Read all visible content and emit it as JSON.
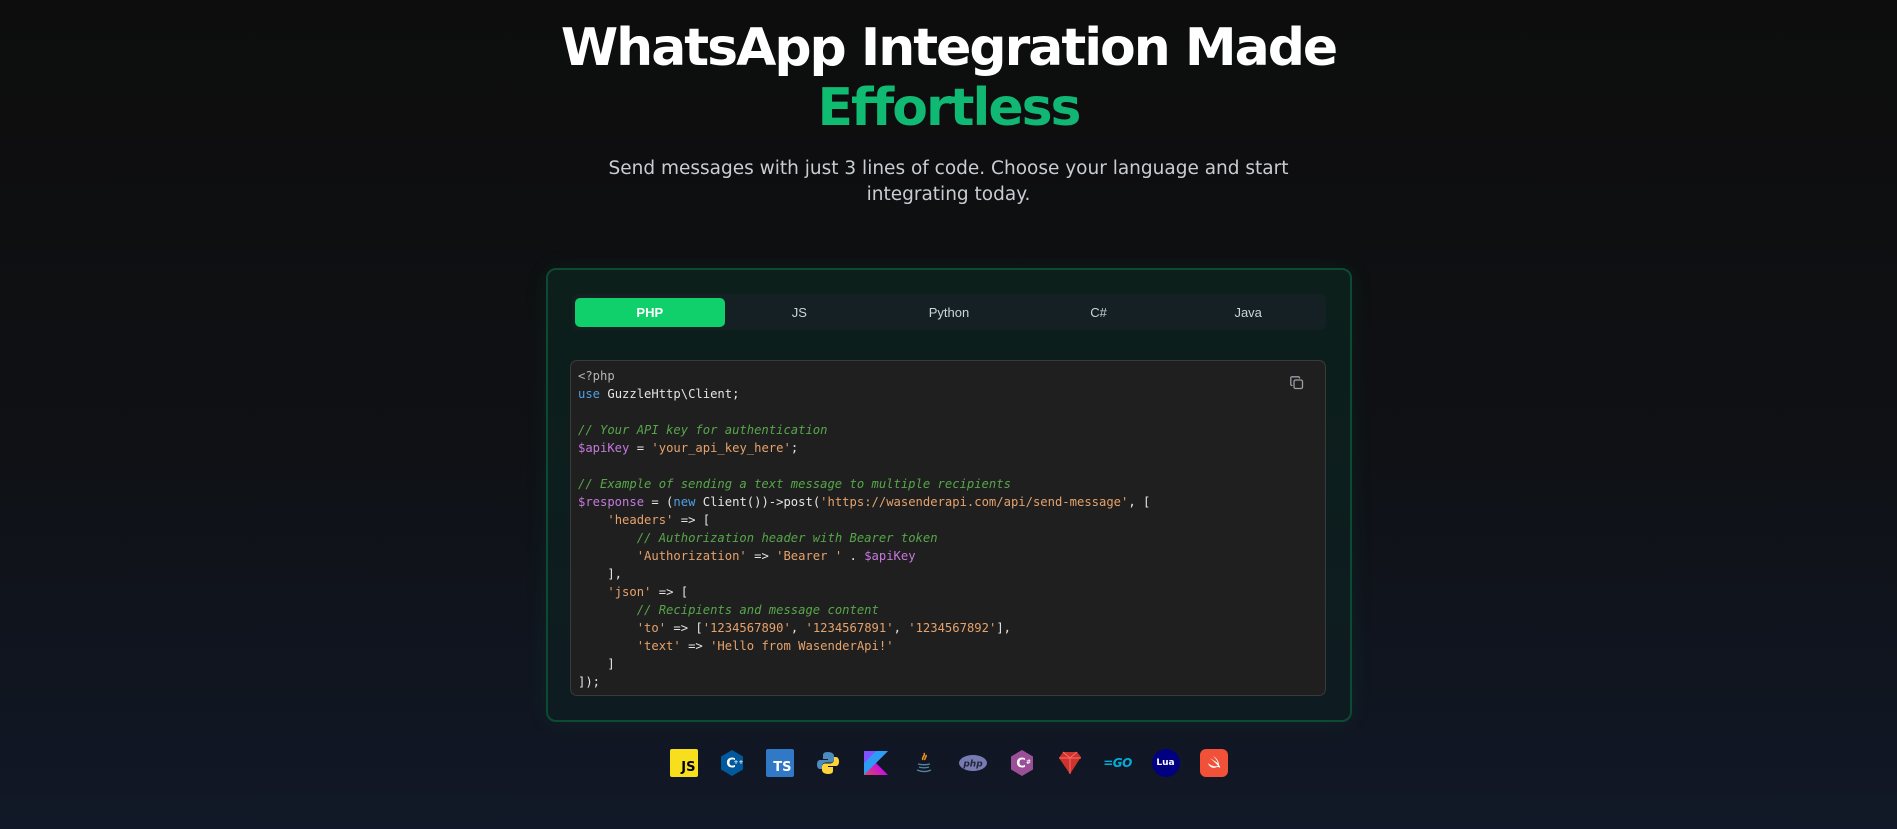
{
  "hero": {
    "title_line1": "WhatsApp Integration Made",
    "title_line2": "Effortless",
    "subtitle": "Send messages with just 3 lines of code. Choose your language and start integrating today."
  },
  "tabs": [
    {
      "label": "PHP",
      "active": true
    },
    {
      "label": "JS",
      "active": false
    },
    {
      "label": "Python",
      "active": false
    },
    {
      "label": "C#",
      "active": false
    },
    {
      "label": "Java",
      "active": false
    }
  ],
  "code": {
    "language": "php",
    "lines": [
      "<?php",
      "use GuzzleHttp\\Client;",
      "",
      "// Your API key for authentication",
      "$apiKey = 'your_api_key_here';",
      "",
      "// Example of sending a text message to multiple recipients",
      "$response = (new Client())->post('https://wasenderapi.com/api/send-message', [",
      "    'headers' => [",
      "        // Authorization header with Bearer token",
      "        'Authorization' => 'Bearer ' . $apiKey",
      "    ],",
      "    'json' => [",
      "        // Recipients and message content",
      "        'to' => ['1234567890', '1234567891', '1234567892'],",
      "        'text' => 'Hello from WasenderApi!'",
      "    ]",
      "]);"
    ],
    "copy_icon": "copy-icon"
  },
  "language_icons": [
    {
      "name": "javascript-icon",
      "label": "JS",
      "bg": "#f7df1e",
      "fg": "#000000"
    },
    {
      "name": "cpp-icon",
      "label": "C",
      "bg": "#00599c",
      "fg": "#ffffff"
    },
    {
      "name": "typescript-icon",
      "label": "TS",
      "bg": "#3178c6",
      "fg": "#ffffff"
    },
    {
      "name": "python-icon",
      "label": "",
      "bg": "#306998",
      "fg": "#ffd43b"
    },
    {
      "name": "kotlin-icon",
      "label": "",
      "bg": "#7f52ff",
      "fg": "#ffffff"
    },
    {
      "name": "java-icon",
      "label": "",
      "bg": "#5382a1",
      "fg": "#f89820"
    },
    {
      "name": "php-icon",
      "label": "php",
      "bg": "#777bb4",
      "fg": "#232531"
    },
    {
      "name": "csharp-icon",
      "label": "C",
      "bg": "#9b4f96",
      "fg": "#ffffff"
    },
    {
      "name": "ruby-icon",
      "label": "",
      "bg": "#cc342d",
      "fg": "#ffffff"
    },
    {
      "name": "go-icon",
      "label": "GO",
      "bg": "#00add8",
      "fg": "#00add8"
    },
    {
      "name": "lua-icon",
      "label": "Lua",
      "bg": "#000080",
      "fg": "#ffffff"
    },
    {
      "name": "swift-icon",
      "label": "",
      "bg": "#f05138",
      "fg": "#ffffff"
    }
  ]
}
